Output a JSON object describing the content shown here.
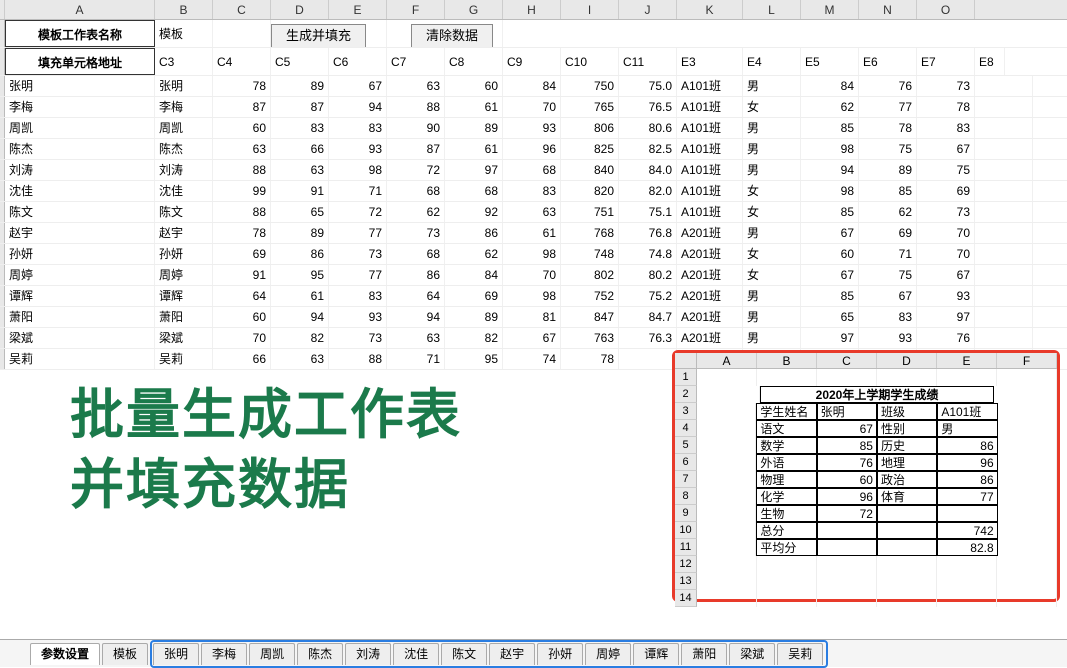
{
  "colHeaders": [
    "A",
    "B",
    "C",
    "D",
    "E",
    "F",
    "G",
    "H",
    "I",
    "J",
    "K",
    "L",
    "M",
    "N",
    "O"
  ],
  "topLabels": {
    "a1": "模板工作表名称",
    "a2": "填充单元格地址",
    "b1": "模板",
    "btn1": "生成并填充",
    "btn2": "清除数据"
  },
  "cellRefs": [
    "C3",
    "C4",
    "C5",
    "C6",
    "C7",
    "C8",
    "C9",
    "C10",
    "C11",
    "E3",
    "E4",
    "E5",
    "E6",
    "E7",
    "E8"
  ],
  "rows": [
    {
      "a": "张明",
      "b": "张明",
      "v": [
        78,
        89,
        67,
        63,
        60,
        84,
        750,
        75.0
      ],
      "k": "A101班",
      "l": "男",
      "r": [
        84,
        76,
        73,
        ""
      ]
    },
    {
      "a": "李梅",
      "b": "李梅",
      "v": [
        87,
        87,
        94,
        88,
        61,
        70,
        765,
        76.5
      ],
      "k": "A101班",
      "l": "女",
      "r": [
        62,
        77,
        78,
        ""
      ]
    },
    {
      "a": "周凯",
      "b": "周凯",
      "v": [
        60,
        83,
        83,
        90,
        89,
        93,
        806,
        80.6
      ],
      "k": "A101班",
      "l": "男",
      "r": [
        85,
        78,
        83,
        ""
      ]
    },
    {
      "a": "陈杰",
      "b": "陈杰",
      "v": [
        63,
        66,
        93,
        87,
        61,
        96,
        825,
        82.5
      ],
      "k": "A101班",
      "l": "男",
      "r": [
        98,
        75,
        67,
        ""
      ]
    },
    {
      "a": "刘涛",
      "b": "刘涛",
      "v": [
        88,
        63,
        98,
        72,
        97,
        68,
        840,
        84.0
      ],
      "k": "A101班",
      "l": "男",
      "r": [
        94,
        89,
        75,
        ""
      ]
    },
    {
      "a": "沈佳",
      "b": "沈佳",
      "v": [
        99,
        91,
        71,
        68,
        68,
        83,
        820,
        82.0
      ],
      "k": "A101班",
      "l": "女",
      "r": [
        98,
        85,
        69,
        ""
      ]
    },
    {
      "a": "陈文",
      "b": "陈文",
      "v": [
        88,
        65,
        72,
        62,
        92,
        63,
        751,
        75.1
      ],
      "k": "A101班",
      "l": "女",
      "r": [
        85,
        62,
        73,
        ""
      ]
    },
    {
      "a": "赵宇",
      "b": "赵宇",
      "v": [
        78,
        89,
        77,
        73,
        86,
        61,
        768,
        76.8
      ],
      "k": "A201班",
      "l": "男",
      "r": [
        67,
        69,
        70,
        ""
      ]
    },
    {
      "a": "孙妍",
      "b": "孙妍",
      "v": [
        69,
        86,
        73,
        68,
        62,
        98,
        748,
        74.8
      ],
      "k": "A201班",
      "l": "女",
      "r": [
        60,
        71,
        70,
        ""
      ]
    },
    {
      "a": "周婷",
      "b": "周婷",
      "v": [
        91,
        95,
        77,
        86,
        84,
        70,
        802,
        80.2
      ],
      "k": "A201班",
      "l": "女",
      "r": [
        67,
        75,
        67,
        ""
      ]
    },
    {
      "a": "谭辉",
      "b": "谭辉",
      "v": [
        64,
        61,
        83,
        64,
        69,
        98,
        752,
        75.2
      ],
      "k": "A201班",
      "l": "男",
      "r": [
        85,
        67,
        93,
        ""
      ]
    },
    {
      "a": "萧阳",
      "b": "萧阳",
      "v": [
        60,
        94,
        93,
        94,
        89,
        81,
        847,
        84.7
      ],
      "k": "A201班",
      "l": "男",
      "r": [
        65,
        83,
        97,
        ""
      ]
    },
    {
      "a": "梁斌",
      "b": "梁斌",
      "v": [
        70,
        82,
        73,
        63,
        82,
        67,
        763,
        76.3
      ],
      "k": "A201班",
      "l": "男",
      "r": [
        97,
        93,
        76,
        ""
      ]
    },
    {
      "a": "吴莉",
      "b": "吴莉",
      "v": [
        66,
        63,
        88,
        71,
        95,
        74,
        "78",
        ""
      ],
      "k": "",
      "l": "",
      "r": [
        "",
        "",
        "",
        ""
      ]
    }
  ],
  "overlay": "批量生成工作表\n并填充数据",
  "inset": {
    "cols": [
      "A",
      "B",
      "C",
      "D",
      "E",
      "F"
    ],
    "title": "2020年上学期学生成绩",
    "rows": [
      [
        "",
        "学生姓名",
        "张明",
        "班级",
        "A101班",
        ""
      ],
      [
        "",
        "语文",
        "67",
        "性别",
        "男",
        ""
      ],
      [
        "",
        "数学",
        "85",
        "历史",
        "86",
        ""
      ],
      [
        "",
        "外语",
        "76",
        "地理",
        "96",
        ""
      ],
      [
        "",
        "物理",
        "60",
        "政治",
        "86",
        ""
      ],
      [
        "",
        "化学",
        "96",
        "体育",
        "77",
        ""
      ],
      [
        "",
        "生物",
        "72",
        "",
        "",
        ""
      ],
      [
        "",
        "总分",
        "",
        "",
        "742",
        ""
      ],
      [
        "",
        "平均分",
        "",
        "",
        "82.8",
        ""
      ]
    ]
  },
  "tabs": {
    "first": [
      "参数设置",
      "模板"
    ],
    "names": [
      "张明",
      "李梅",
      "周凯",
      "陈杰",
      "刘涛",
      "沈佳",
      "陈文",
      "赵宇",
      "孙妍",
      "周婷",
      "谭辉",
      "萧阳",
      "梁斌",
      "吴莉"
    ]
  }
}
